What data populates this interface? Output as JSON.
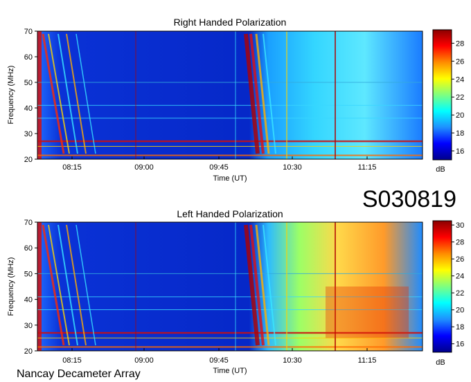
{
  "station_id": "S030819",
  "footer": "Nancay Decameter Array",
  "colorscale": [
    "#00008b",
    "#0000ff",
    "#1e90ff",
    "#00ffff",
    "#7fff7f",
    "#ffff00",
    "#ff8c00",
    "#ff0000",
    "#8b0000"
  ],
  "chart_data": [
    {
      "type": "heatmap",
      "title": "Right Handed Polarization",
      "xlabel": "Time (UT)",
      "ylabel": "Frequency (MHz)",
      "x_ticks": [
        "08:15",
        "09:00",
        "09:45",
        "10:30",
        "11:15"
      ],
      "y_ticks": [
        20,
        30,
        40,
        50,
        60,
        70
      ],
      "ylim": [
        20,
        70
      ],
      "colorbar": {
        "label": "dB",
        "ticks": [
          16,
          18,
          20,
          22,
          24,
          26,
          28
        ],
        "range": [
          15,
          29.5
        ]
      }
    },
    {
      "type": "heatmap",
      "title": "Left Handed Polarization",
      "xlabel": "Time (UT)",
      "ylabel": "Frequency (MHz)",
      "x_ticks": [
        "08:15",
        "09:00",
        "09:45",
        "10:30",
        "11:15"
      ],
      "y_ticks": [
        20,
        30,
        40,
        50,
        60,
        70
      ],
      "ylim": [
        20,
        70
      ],
      "colorbar": {
        "label": "dB",
        "ticks": [
          16,
          18,
          20,
          22,
          24,
          26,
          28,
          30
        ],
        "range": [
          15,
          30.5
        ]
      }
    }
  ]
}
